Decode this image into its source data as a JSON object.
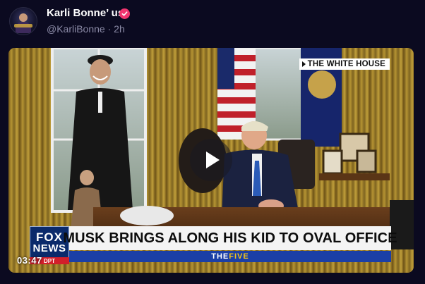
{
  "post": {
    "display_name": "Karli Bonne’ us",
    "handle": "@KarliBonne",
    "separator": "·",
    "time": "2h",
    "verified": true,
    "accent_color": "#f0356f"
  },
  "video": {
    "network_tag": "THE WHITE HOUSE",
    "chyron": "MUSK BRINGS ALONG HIS KID TO OVAL OFFICE",
    "show_prefix": "THE",
    "show_name": "FIVE",
    "logo_line1": "FOX",
    "logo_line2": "NEWS",
    "logo_sub": "DPT",
    "duration": "03:47",
    "play_icon": "play-icon"
  }
}
